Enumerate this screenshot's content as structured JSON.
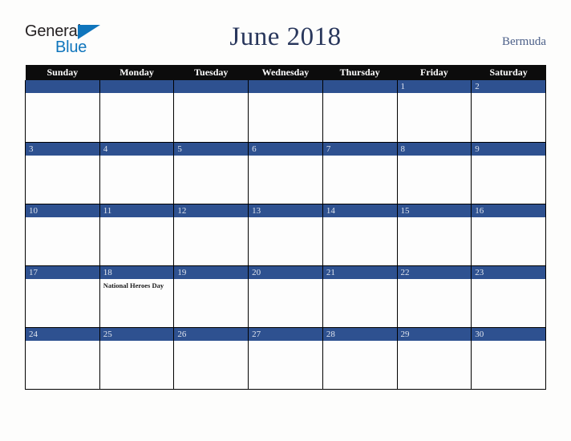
{
  "brand": {
    "name_part1": "General",
    "name_part2": "Blue",
    "triangle_icon": "blue-triangle-icon",
    "color_dark": "#231f20",
    "color_blue": "#0f75bc"
  },
  "header": {
    "title": "June 2018",
    "locale": "Bermuda",
    "title_color": "#29375c",
    "locale_color": "#4b5f88"
  },
  "calendar": {
    "month": "June",
    "year": "2018",
    "header_bg": "#0c0c0c",
    "daynum_bg": "#2e5190",
    "daynum_color": "#dfe4ee",
    "weekday_headers": [
      "Sunday",
      "Monday",
      "Tuesday",
      "Wednesday",
      "Thursday",
      "Friday",
      "Saturday"
    ],
    "weeks": [
      [
        {
          "day": "",
          "events": []
        },
        {
          "day": "",
          "events": []
        },
        {
          "day": "",
          "events": []
        },
        {
          "day": "",
          "events": []
        },
        {
          "day": "",
          "events": []
        },
        {
          "day": "1",
          "events": []
        },
        {
          "day": "2",
          "events": []
        }
      ],
      [
        {
          "day": "3",
          "events": []
        },
        {
          "day": "4",
          "events": []
        },
        {
          "day": "5",
          "events": []
        },
        {
          "day": "6",
          "events": []
        },
        {
          "day": "7",
          "events": []
        },
        {
          "day": "8",
          "events": []
        },
        {
          "day": "9",
          "events": []
        }
      ],
      [
        {
          "day": "10",
          "events": []
        },
        {
          "day": "11",
          "events": []
        },
        {
          "day": "12",
          "events": []
        },
        {
          "day": "13",
          "events": []
        },
        {
          "day": "14",
          "events": []
        },
        {
          "day": "15",
          "events": []
        },
        {
          "day": "16",
          "events": []
        }
      ],
      [
        {
          "day": "17",
          "events": []
        },
        {
          "day": "18",
          "events": [
            "National Heroes Day"
          ]
        },
        {
          "day": "19",
          "events": []
        },
        {
          "day": "20",
          "events": []
        },
        {
          "day": "21",
          "events": []
        },
        {
          "day": "22",
          "events": []
        },
        {
          "day": "23",
          "events": []
        }
      ],
      [
        {
          "day": "24",
          "events": []
        },
        {
          "day": "25",
          "events": []
        },
        {
          "day": "26",
          "events": []
        },
        {
          "day": "27",
          "events": []
        },
        {
          "day": "28",
          "events": []
        },
        {
          "day": "29",
          "events": []
        },
        {
          "day": "30",
          "events": []
        }
      ]
    ]
  }
}
